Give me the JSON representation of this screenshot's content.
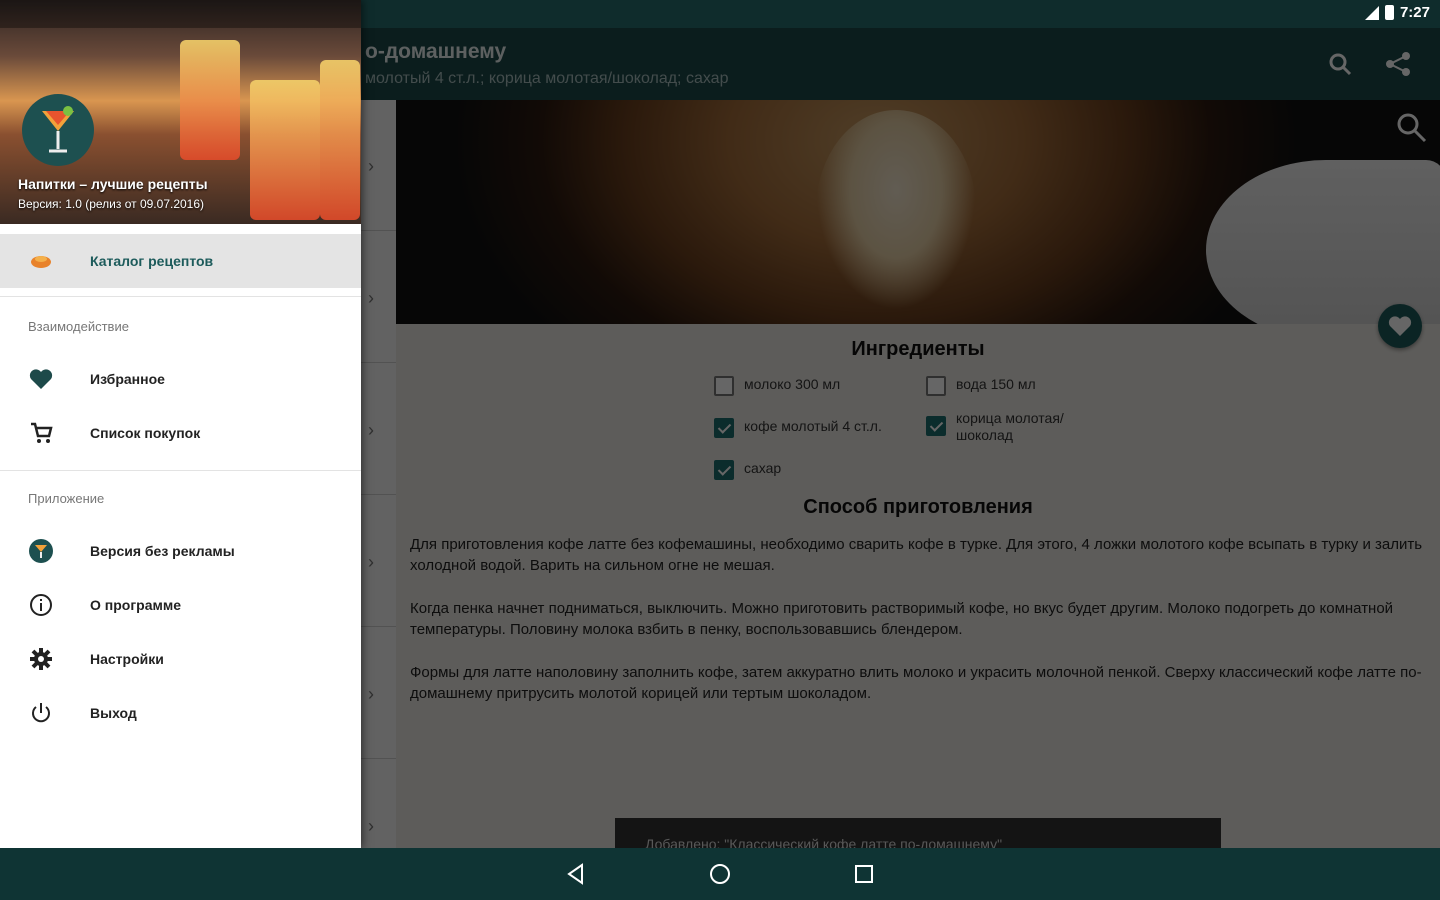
{
  "status_bar": {
    "time": "7:27"
  },
  "app_bar": {
    "title": "о-домашнему",
    "subtitle": "молотый 4 ст.л.; корица молотая/шоколад; сахар"
  },
  "recipe": {
    "ingredients_title": "Ингредиенты",
    "ingredients": [
      {
        "label": "молоко 300 мл",
        "checked": false
      },
      {
        "label": "вода 150 мл",
        "checked": false
      },
      {
        "label": "кофе молотый 4 ст.л.",
        "checked": true
      },
      {
        "label": "корица молотая/\nшоколад",
        "checked": true
      },
      {
        "label": "сахар",
        "checked": true
      }
    ],
    "method_title": "Способ приготовления",
    "paragraphs": [
      "Для приготовления кофе латте без кофемашины, необходимо сварить кофе в турке. Для этого, 4 ложки молотого кофе всыпать в турку и залить холодной водой. Варить на сильном огне не мешая.",
      "Когда пенка начнет подниматься, выключить. Можно приготовить растворимый кофе, но вкус будет другим. Молоко подогреть до комнатной температуры. Половину молока взбить в пенку, воспользовавшись блендером.",
      "Формы для латте наполовину заполнить кофе, затем аккуратно влить молоко и украсить молочной пенкой. Сверху классический кофе латте по-домашнему притрусить молотой корицей или тертым шоколадом."
    ]
  },
  "toast": {
    "text": "Добавлено: \"Классический кофе латте по-домашнему\""
  },
  "drawer": {
    "app_name": "Напитки – лучшие рецепты",
    "app_version": "Версия: 1.0 (релиз от 09.07.2016)",
    "catalog": "Каталог рецептов",
    "group_interaction": "Взаимодействие",
    "favorites": "Избранное",
    "shopping_list": "Список покупок",
    "group_app": "Приложение",
    "no_ads": "Версия без рекламы",
    "about": "О программе",
    "settings": "Настройки",
    "exit": "Выход"
  },
  "colors": {
    "primary": "#1d4a4a",
    "accent": "#1d6f6f",
    "nav_bar": "#0f3434"
  },
  "icons": [
    "search-icon",
    "share-icon",
    "heart-icon",
    "cart-icon",
    "cocktail-icon",
    "info-icon",
    "gear-icon",
    "power-icon",
    "back-icon",
    "home-icon",
    "recents-icon"
  ]
}
